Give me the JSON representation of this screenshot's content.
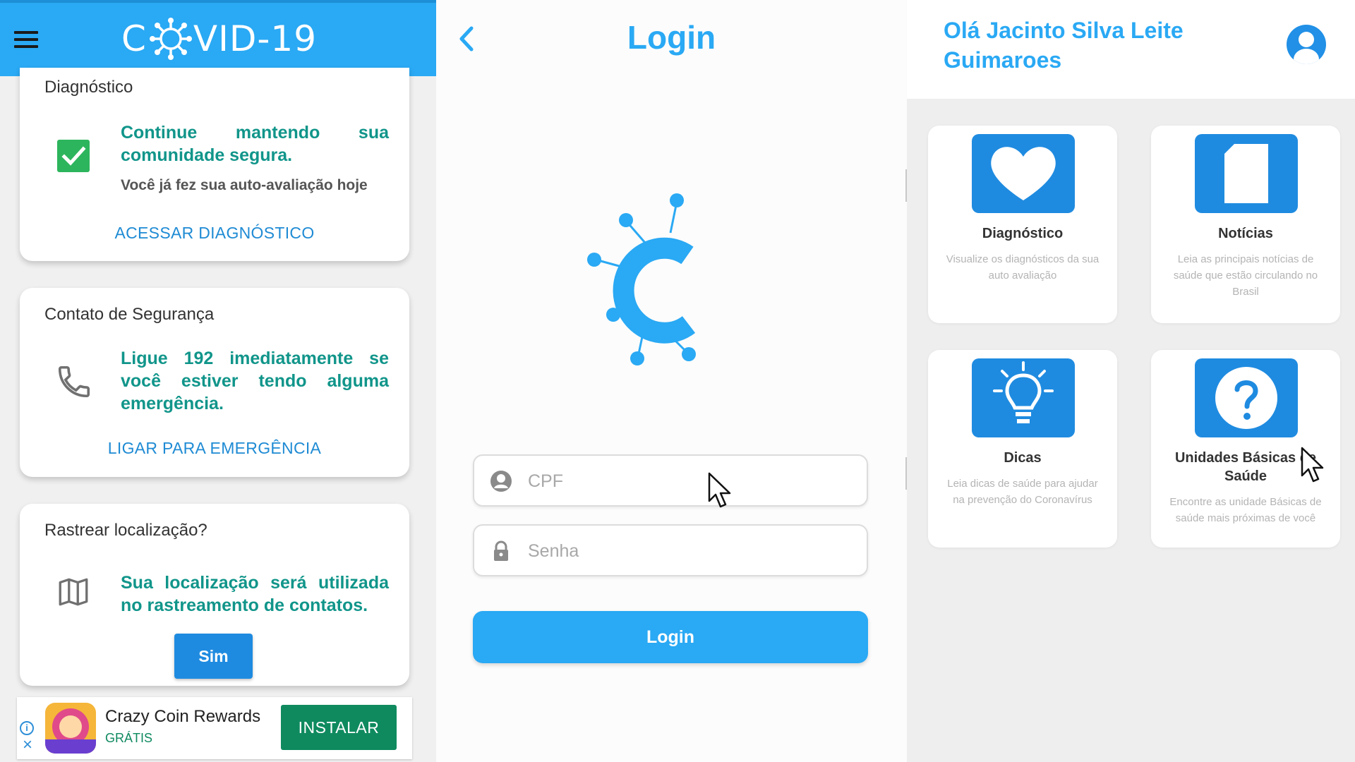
{
  "panel_left": {
    "app_bar": {
      "brand_prefix": "C",
      "brand_suffix": "VID-19"
    },
    "diagnostic_card": {
      "title": "Diagnóstico",
      "message": "Continue mantendo sua comunidade segura.",
      "sub": "Você já fez sua auto-avaliação hoje",
      "link": "ACESSAR DIAGNÓSTICO"
    },
    "safety_card": {
      "title": "Contato de Segurança",
      "message": "Ligue 192 imediatamente se você estiver tendo alguma emergência.",
      "link": "LIGAR PARA EMERGÊNCIA"
    },
    "tracking_card": {
      "title": "Rastrear localização?",
      "message": "Sua localização será utilizada no rastreamento de contatos.",
      "button": "Sim"
    },
    "ad": {
      "title": "Crazy Coin Rewards",
      "sub": "GRÁTIS",
      "button": "INSTALAR",
      "info_glyph": "i",
      "close_glyph": "×"
    }
  },
  "panel_middle": {
    "title": "Login",
    "cpf_placeholder": "CPF",
    "senha_placeholder": "Senha",
    "login_button": "Login"
  },
  "panel_right": {
    "greeting": "Olá Jacinto Silva Leite Guimaroes",
    "tiles": [
      {
        "name": "Diagnóstico",
        "desc": "Visualize os diagnósticos da sua auto avaliação",
        "icon": "heart-icon"
      },
      {
        "name": "Notícias",
        "desc": "Leia as principais notícias de saúde que estão circulando no Brasil",
        "icon": "document-icon"
      },
      {
        "name": "Dicas",
        "desc": "Leia dicas de saúde para ajudar na prevenção do Coronavírus",
        "icon": "lightbulb-icon"
      },
      {
        "name": "Unidades Básicas de Saúde",
        "desc": "Encontre as unidade Básicas de saúde mais próximas de você",
        "icon": "question-icon"
      }
    ]
  },
  "colors": {
    "primary": "#2aa9f4",
    "teal_text": "#11958a",
    "link_blue": "#1f8bd4",
    "button_blue": "#1f8be0",
    "check_green": "#2db55d",
    "ad_green": "#0f8a5f"
  }
}
